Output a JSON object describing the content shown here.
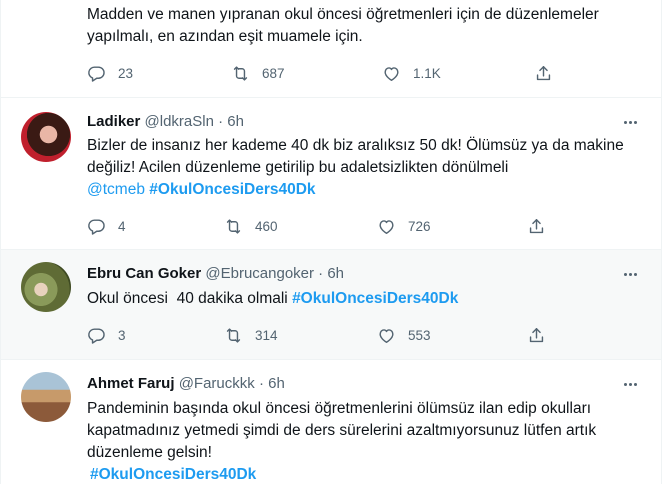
{
  "tweets": [
    {
      "text": "Madden ve manen yıpranan okul öncesi öğretmenleri için de düzenlemeler yapılmalı, en azından eşit muamele için.",
      "reply_count": "23",
      "retweet_count": "687",
      "like_count": "1.1K"
    },
    {
      "name": "Ladiker",
      "handle": "@ldkraSln",
      "dot": "·",
      "time": "6h",
      "text": "Bizler de insanız her kademe 40 dk biz aralıksız 50 dk! Ölümsüz ya da makine değiliz! Acilen düzenleme getirilip bu adaletsizlikten dönülmeli",
      "mention": "@tcmeb",
      "hashtag": "#OkulOncesiDers40Dk",
      "reply_count": "4",
      "retweet_count": "460",
      "like_count": "726"
    },
    {
      "name": "Ebru Can Goker",
      "handle": "@Ebrucangoker",
      "dot": "·",
      "time": "6h",
      "text": "Okul öncesi  40 dakika olmali",
      "hashtag": "#OkulOncesiDers40Dk",
      "reply_count": "3",
      "retweet_count": "314",
      "like_count": "553"
    },
    {
      "name": "Ahmet Faruj",
      "handle": "@Faruckkk",
      "dot": "·",
      "time": "6h",
      "text": "Pandeminin başında okul öncesi öğretmenlerini ölümsüz ilan edip okulları kapatmadınız yetmedi şimdi de ders sürelerini azaltmıyorsunuz lütfen artık düzenleme gelsin!",
      "hashtag": "#OkulOncesiDers40Dk"
    }
  ],
  "colors": {
    "accent": "#1d9bf0",
    "muted": "#536471",
    "text": "#0f1419",
    "hover_bg": "#f7f9f9"
  },
  "icons": [
    "reply-icon",
    "retweet-icon",
    "like-icon",
    "share-icon",
    "more-icon"
  ]
}
